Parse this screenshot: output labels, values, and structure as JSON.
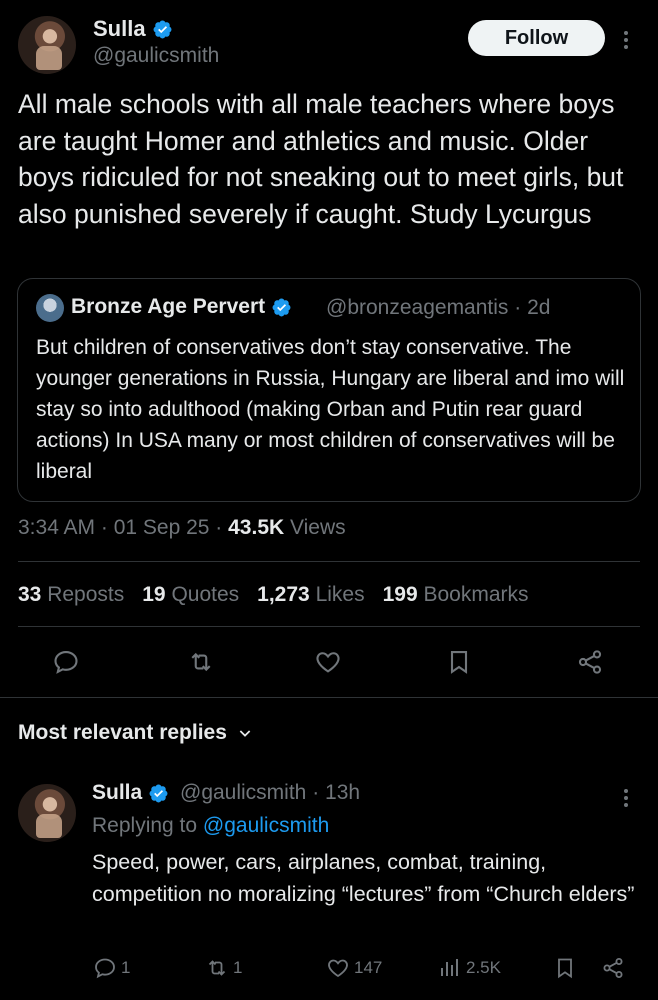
{
  "post": {
    "author_name": "Sulla",
    "author_handle": "@gaulicsmith",
    "follow_label": "Follow",
    "more_label": "⋮",
    "text": "All male schools with all male teachers where boys are taught Homer and athletics and music. Older boys ridiculed for not sneaking out to meet girls, but also punished severely if caught. Study Lycurgus",
    "time": "3:34 AM · 01 Sep 25 · ",
    "views_count": "43.5K",
    "views_label": " Views"
  },
  "quote": {
    "author_name": "Bronze Age Pervert",
    "author_handle": "@bronzeagemantis · 2d",
    "text": "But children of conservatives don’t stay conservative. The younger generations in Russia, Hungary are liberal and imo will stay so into adulthood (making Orban and Putin rear guard actions) In USA many or most children of conservatives will be liberal"
  },
  "stats": {
    "reposts_count": "33",
    "reposts_label": "Reposts",
    "quotes_count": "19",
    "quotes_label": "Quotes",
    "likes_count": "1,273",
    "likes_label": "Likes",
    "bookmarks_count": "199",
    "bookmarks_label": "Bookmarks"
  },
  "replies_header": {
    "label": "Most relevant replies"
  },
  "reply": {
    "author_name": "Sulla",
    "author_handle": "@gaulicsmith · 13h",
    "replying_prefix": "Replying to ",
    "replying_handle": "@gaulicsmith",
    "text": "Speed, power, cars, airplanes, combat, training, competition no moralizing “lectures” from “Church elders”",
    "reply_count": "1",
    "repost_count": "1",
    "like_count": "147",
    "view_count": "2.5K"
  },
  "colors": {
    "accent": "#1d9bf0",
    "muted": "#71767b",
    "text": "#e7e9ea",
    "border": "#2f3336"
  },
  "icons": [
    "verified-badge-icon",
    "more-icon",
    "reply-icon",
    "repost-icon",
    "like-icon",
    "bookmark-icon",
    "share-icon",
    "views-icon",
    "chevron-down-icon"
  ]
}
